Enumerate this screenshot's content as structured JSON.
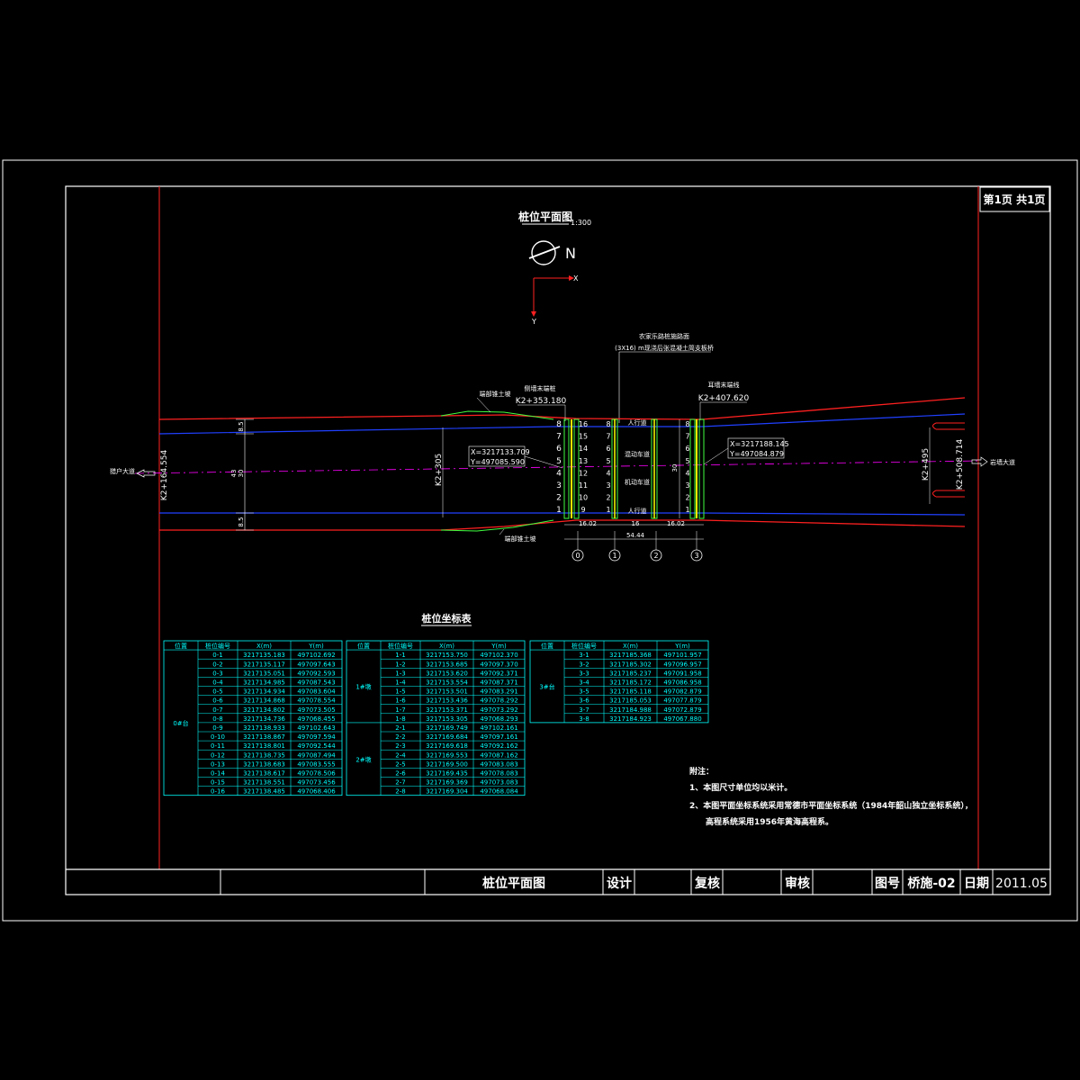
{
  "colors": {
    "background": "#000000",
    "frame": "#ffffff",
    "road_edge": "#ff2020",
    "lane_line": "#2040ff",
    "centerline": "#ff00ff",
    "slope": "#40ff40",
    "pier": "#ffff00",
    "table_text": "#00ffff",
    "leader": "#ffffff"
  },
  "header": {
    "page_label": "第1页  共1页"
  },
  "plan": {
    "title": "桩位平面图",
    "scale": "1:300",
    "north_label": "N",
    "axis_x": "X",
    "axis_y": "Y",
    "annotation_top_line1": "农家乐路桩施路面",
    "annotation_top_line2": "(3X16) m现浇后张混凝土简支板桥",
    "slope_label_top": "端部锥土坡",
    "slope_label_bottom": "端部锥土坡",
    "left_abutment_label": "侧墙末端桩",
    "left_abutment_station": "K2+353.180",
    "right_abutment_label": "耳墙末端线",
    "right_abutment_station": "K2+407.620",
    "left_station": "K2+164.554",
    "mid_station": "K2+305",
    "right_station_a": "K2+495",
    "right_station_b": "K2+508.714",
    "left_dir": "猎户大道",
    "right_dir": "岩墙大道",
    "coord_left_x": "X=3217133.709",
    "coord_left_y": "Y=497085.590",
    "coord_right_x": "X=3217188.145",
    "coord_right_y": "Y=497084.879",
    "dim_left_top": "8.5",
    "dim_left_mid": "30",
    "dim_left_total": "43",
    "dim_left_bottom": "8.5",
    "dim_bridge_width": "30",
    "span_left": "16.02",
    "span_mid": "16",
    "span_right": "16.02",
    "span_total": "54.44",
    "axis_labels": [
      "0",
      "1",
      "2",
      "3"
    ],
    "pile_numbers_left": [
      "8",
      "7",
      "6",
      "5",
      "4",
      "3",
      "2",
      "1"
    ],
    "pile_numbers_right": [
      "16",
      "15",
      "14",
      "13",
      "12",
      "11",
      "10",
      "9"
    ],
    "pile_numbers_pier": [
      "8",
      "7",
      "6",
      "5",
      "4",
      "3",
      "2",
      "1"
    ],
    "pile_numbers_right_abut": [
      "8",
      "7",
      "6",
      "5",
      "4",
      "3",
      "2",
      "1"
    ],
    "lane_top": "人行道",
    "lane_mid1": "混动车道",
    "lane_mid2": "机动车道",
    "lane_bottom": "人行道"
  },
  "table": {
    "title": "桩位坐标表",
    "headers": [
      "位置",
      "桩位编号",
      "X(m)",
      "Y(m)"
    ],
    "group0": {
      "label": "0#台",
      "rows": [
        [
          "0-1",
          "3217135.183",
          "497102.692"
        ],
        [
          "0-2",
          "3217135.117",
          "497097.643"
        ],
        [
          "0-3",
          "3217135.051",
          "497092.593"
        ],
        [
          "0-4",
          "3217134.985",
          "497087.543"
        ],
        [
          "0-5",
          "3217134.934",
          "497083.604"
        ],
        [
          "0-6",
          "3217134.868",
          "497078.554"
        ],
        [
          "0-7",
          "3217134.802",
          "497073.505"
        ],
        [
          "0-8",
          "3217134.736",
          "497068.455"
        ],
        [
          "0-9",
          "3217138.933",
          "497102.643"
        ],
        [
          "0-10",
          "3217138.867",
          "497097.594"
        ],
        [
          "0-11",
          "3217138.801",
          "497092.544"
        ],
        [
          "0-12",
          "3217138.735",
          "497087.494"
        ],
        [
          "0-13",
          "3217138.683",
          "497083.555"
        ],
        [
          "0-14",
          "3217138.617",
          "497078.506"
        ],
        [
          "0-15",
          "3217138.551",
          "497073.456"
        ],
        [
          "0-16",
          "3217138.485",
          "497068.406"
        ]
      ]
    },
    "group1": {
      "label": "1#墩",
      "rows": [
        [
          "1-1",
          "3217153.750",
          "497102.370"
        ],
        [
          "1-2",
          "3217153.685",
          "497097.370"
        ],
        [
          "1-3",
          "3217153.620",
          "497092.371"
        ],
        [
          "1-4",
          "3217153.554",
          "497087.371"
        ],
        [
          "1-5",
          "3217153.501",
          "497083.291"
        ],
        [
          "1-6",
          "3217153.436",
          "497078.292"
        ],
        [
          "1-7",
          "3217153.371",
          "497073.292"
        ],
        [
          "1-8",
          "3217153.305",
          "497068.293"
        ]
      ]
    },
    "group2": {
      "label": "2#墩",
      "rows": [
        [
          "2-1",
          "3217169.749",
          "497102.161"
        ],
        [
          "2-2",
          "3217169.684",
          "497097.161"
        ],
        [
          "2-3",
          "3217169.618",
          "497092.162"
        ],
        [
          "2-4",
          "3217169.553",
          "497087.162"
        ],
        [
          "2-5",
          "3217169.500",
          "497083.083"
        ],
        [
          "2-6",
          "3217169.435",
          "497078.083"
        ],
        [
          "2-7",
          "3217169.369",
          "497073.083"
        ],
        [
          "2-8",
          "3217169.304",
          "497068.084"
        ]
      ]
    },
    "group3": {
      "label": "3#台",
      "rows": [
        [
          "3-1",
          "3217185.368",
          "497101.957"
        ],
        [
          "3-2",
          "3217185.302",
          "497096.957"
        ],
        [
          "3-3",
          "3217185.237",
          "497091.958"
        ],
        [
          "3-4",
          "3217185.172",
          "497086.958"
        ],
        [
          "3-5",
          "3217185.118",
          "497082.879"
        ],
        [
          "3-6",
          "3217185.053",
          "497077.879"
        ],
        [
          "3-7",
          "3217184.988",
          "497072.879"
        ],
        [
          "3-8",
          "3217184.923",
          "497067.880"
        ]
      ]
    }
  },
  "notes": {
    "title": "附注：",
    "line1": "1、本图尺寸单位均以米计。",
    "line2": "2、本图平面坐标系统采用常德市平面坐标系统（1984年韶山独立坐标系统），",
    "line3": "高程系统采用1956年黄海高程系。"
  },
  "title_block": {
    "drawing_name": "桩位平面图",
    "design": "设计",
    "review": "复核",
    "approve": "审核",
    "drawing_no_label": "图号",
    "drawing_no": "桥施-02",
    "date_label": "日期",
    "date": "2011.05"
  }
}
